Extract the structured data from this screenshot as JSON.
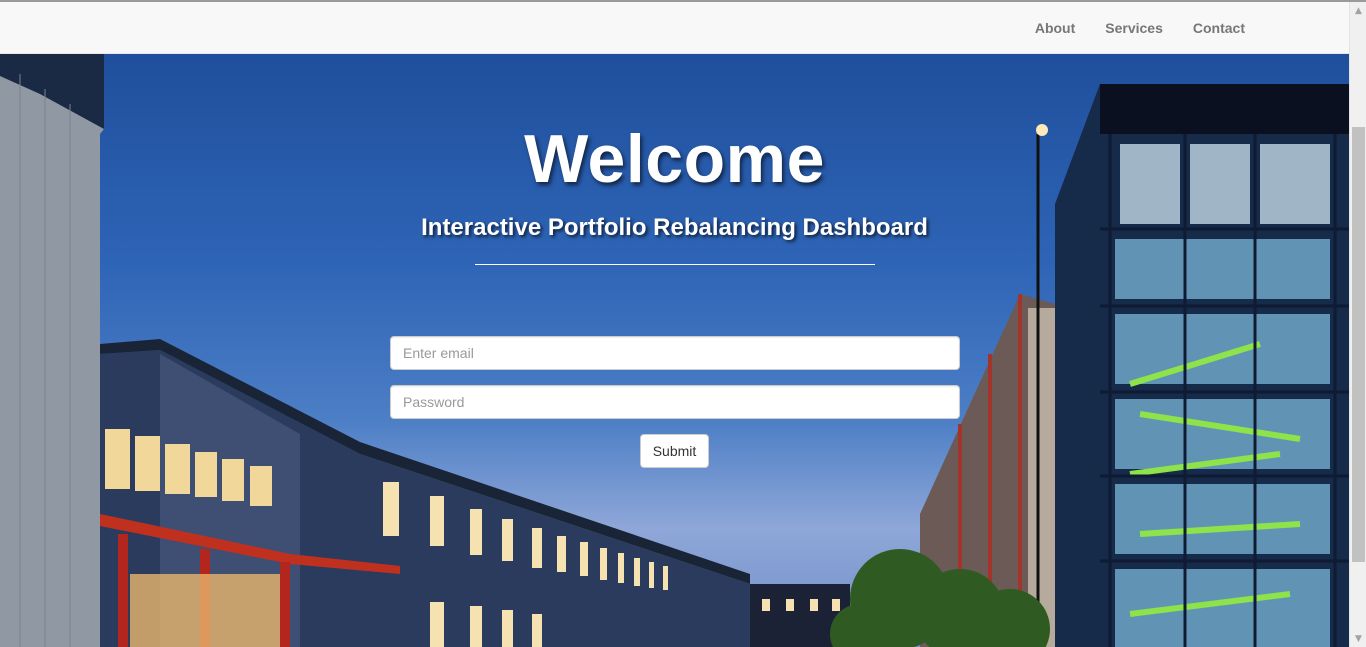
{
  "nav": {
    "links": [
      {
        "label": "About"
      },
      {
        "label": "Services"
      },
      {
        "label": "Contact"
      }
    ]
  },
  "hero": {
    "title": "Welcome",
    "subtitle": "Interactive Portfolio Rebalancing Dashboard"
  },
  "form": {
    "email": {
      "placeholder": "Enter email",
      "value": ""
    },
    "password": {
      "placeholder": "Password",
      "value": ""
    },
    "submit_label": "Submit"
  },
  "scrollbar": {
    "up_icon": "chevron-up-icon",
    "down_icon": "chevron-down-icon"
  },
  "colors": {
    "navbar_bg": "#f8f8f8",
    "nav_link": "#777777",
    "sky_top": "#1f4f9c",
    "sky_bottom": "#8fa7d8",
    "building_red": "#b3261e"
  }
}
